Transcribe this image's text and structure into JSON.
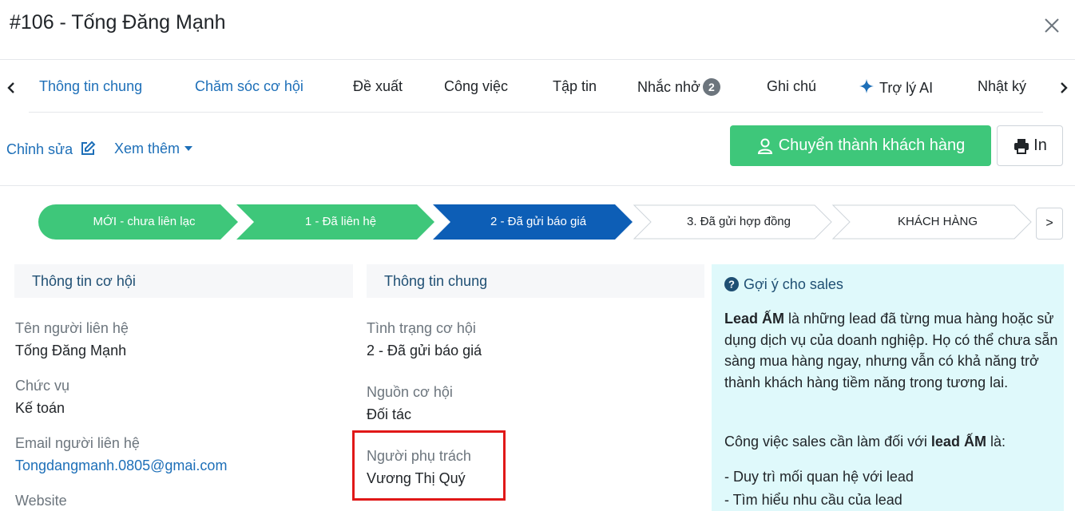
{
  "header": {
    "title": "#106 - Tống Đăng Mạnh"
  },
  "tabs": [
    {
      "label": "Thông tin chung"
    },
    {
      "label": "Chăm sóc cơ hội"
    },
    {
      "label": "Đề xuất"
    },
    {
      "label": "Công việc"
    },
    {
      "label": "Tập tin"
    },
    {
      "label": "Nhắc nhở",
      "badge": "2"
    },
    {
      "label": "Ghi chú"
    },
    {
      "label": "Trợ lý AI"
    },
    {
      "label": "Nhật ký"
    }
  ],
  "actions": {
    "edit_label": "Chỉnh sửa",
    "more_label": "Xem thêm",
    "convert_label": "Chuyển thành khách hàng",
    "print_label": "In"
  },
  "stages": [
    {
      "label": "MỚI - chưa liên lạc",
      "status": "done"
    },
    {
      "label": "1 - Đã liên hệ",
      "status": "done"
    },
    {
      "label": "2 - Đã gửi báo giá",
      "status": "current"
    },
    {
      "label": "3. Đã gửi hợp đồng",
      "status": "todo"
    },
    {
      "label": "KHÁCH HÀNG",
      "status": "todo"
    }
  ],
  "stage_next": ">",
  "colors": {
    "done": "#3ec77a",
    "current": "#0d5eb6",
    "accent": "#1d6fb8",
    "tips_bg": "#dff9fb"
  },
  "opportunity": {
    "header": "Thông tin cơ hội",
    "fields": [
      {
        "label": "Tên người liên hệ",
        "value": "Tống Đăng Mạnh"
      },
      {
        "label": "Chức vụ",
        "value": "Kế toán"
      },
      {
        "label": "Email người liên hệ",
        "value": "Tongdangmanh.0805@gmai.com"
      },
      {
        "label": "Website",
        "value": ""
      }
    ]
  },
  "general": {
    "header": "Thông tin chung",
    "fields": [
      {
        "label": "Tình trạng cơ hội",
        "value": "2 - Đã gửi báo giá"
      },
      {
        "label": "Nguồn cơ hội",
        "value": "Đối tác"
      },
      {
        "label": "Người phụ trách",
        "value": "Vương Thị Quý"
      }
    ]
  },
  "tips": {
    "title": "Gợi ý cho sales",
    "intro_bold": "Lead ẤM",
    "intro_rest": " là những lead đã từng mua hàng hoặc sử dụng dịch vụ của doanh nghiệp. Họ có thể chưa sẵn sàng mua hàng ngay, nhưng vẫn có khả năng trở thành khách hàng tiềm năng trong tương lai.",
    "task_prefix": "Công việc sales cần làm đối với ",
    "task_bold": "lead ẤM",
    "task_suffix": " là:",
    "items": [
      "- Duy trì mối quan hệ với lead",
      "- Tìm hiểu nhu cầu của lead"
    ]
  }
}
